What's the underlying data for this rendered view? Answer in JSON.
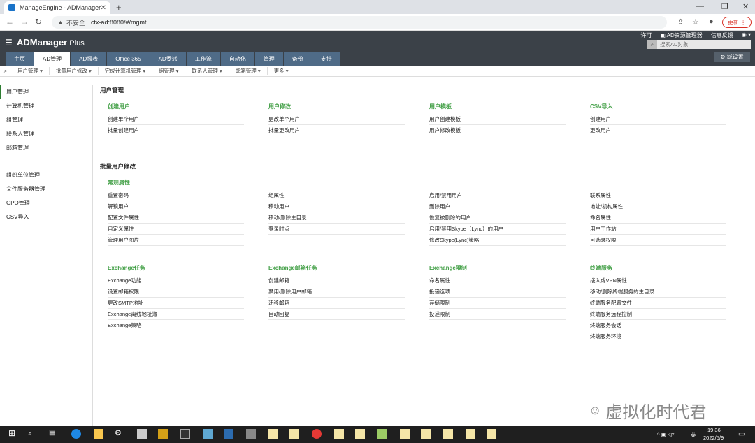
{
  "browser": {
    "tab_title": "ManageEngine - ADManager",
    "not_secure": "不安全",
    "url": "ctx-ad:8080/#/mgmt",
    "update_label": "更新"
  },
  "header": {
    "logo_main": "ADManager",
    "logo_plus": " Plus",
    "links": [
      "许可",
      "AD资源管理器",
      "信息反馈",
      ""
    ],
    "search_placeholder": "搜索AD对象",
    "domain_settings": "域设置"
  },
  "main_tabs": [
    "主页",
    "AD管理",
    "AD报表",
    "Office 365",
    "AD委派",
    "工作流",
    "自动化",
    "管理",
    "备份",
    "支持"
  ],
  "sub_menu": [
    "用户管理",
    "批量用户修改",
    "完成计算机管理",
    "组管理",
    "联系人管理",
    "邮箱管理",
    "更多"
  ],
  "left_nav": {
    "group1": [
      "用户管理",
      "计算机管理",
      "组管理",
      "联系人管理",
      "邮箱管理"
    ],
    "group2": [
      "组织单位管理",
      "文件服务器管理",
      "GPO管理",
      "CSV导入"
    ]
  },
  "user_management": {
    "title": "用户管理",
    "columns": [
      {
        "head": "创建用户",
        "items": [
          "创建单个用户",
          "批量创建用户"
        ]
      },
      {
        "head": "用户修改",
        "items": [
          "更改单个用户",
          "批量更改用户"
        ]
      },
      {
        "head": "用户模板",
        "items": [
          "用户创建模板",
          "用户修改模板"
        ]
      },
      {
        "head": "CSV导入",
        "items": [
          "创建用户",
          "更改用户"
        ]
      }
    ]
  },
  "bulk_modify": {
    "title": "批量用户修改",
    "general": {
      "columns": [
        {
          "head": "常规属性",
          "items": [
            "重置密码",
            "解锁用户",
            "配置文件属性",
            "自定义属性",
            "管理用户图片"
          ]
        },
        {
          "head": "",
          "items": [
            "组属性",
            "移动用户",
            "移动/删除主目录",
            "登录时点"
          ]
        },
        {
          "head": "",
          "items": [
            "启用/禁用用户",
            "删除用户",
            "恢复被删除的用户",
            "启用/禁用Skype（Lync）的用户",
            "修改Skype(Lync)策略"
          ]
        },
        {
          "head": "",
          "items": [
            "联系属性",
            "地址/机构属性",
            "命名属性",
            "用户工作站",
            "可选录权限"
          ]
        }
      ]
    },
    "exchange": {
      "columns": [
        {
          "head": "Exchange任务",
          "items": [
            "Exchange功能",
            "设置邮箱权限",
            "更改SMTP地址",
            "Exchange离线地址簿",
            "Exchange策略"
          ]
        },
        {
          "head": "Exchange邮箱任务",
          "items": [
            "创建邮箱",
            "禁用/删除用户邮箱",
            "迁移邮箱",
            "自动回复"
          ]
        },
        {
          "head": "Exchange限制",
          "items": [
            "命名属性",
            "投递选项",
            "存储限制",
            "投递限制"
          ]
        },
        {
          "head": "终端服务",
          "items": [
            "拨入或VPN属性",
            "移动/删除终端服务的主目录",
            "终端服务配置文件",
            "终端服务远程控制",
            "终端服务会话",
            "终端服务环境"
          ]
        }
      ]
    }
  },
  "watermark": "虚拟化时代君",
  "taskbar": {
    "time": "19:36",
    "date": "2022/5/9",
    "ime": "英"
  }
}
